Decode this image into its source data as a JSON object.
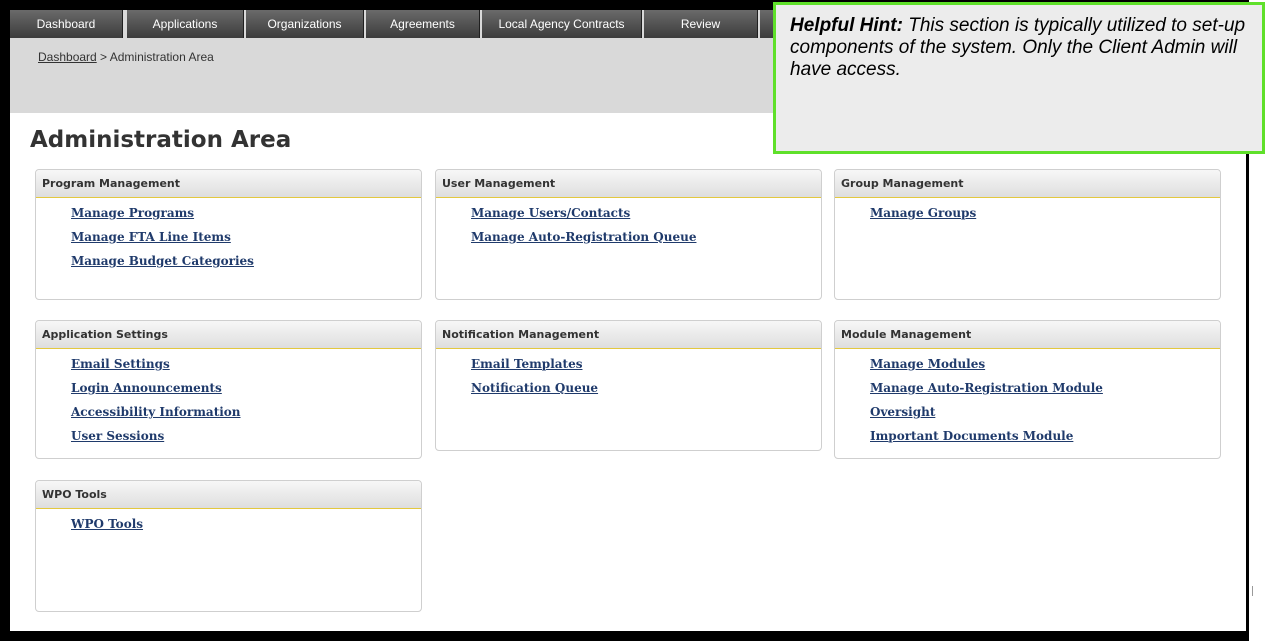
{
  "nav": {
    "tabs": [
      {
        "label": "Dashboard"
      },
      {
        "label": "Applications"
      },
      {
        "label": "Organizations"
      },
      {
        "label": "Agreements"
      },
      {
        "label": "Local Agency Contracts"
      },
      {
        "label": "Review"
      },
      {
        "label": ""
      }
    ]
  },
  "breadcrumb": {
    "home": "Dashboard",
    "separator": " > ",
    "current": "Administration Area"
  },
  "page": {
    "title": "Administration Area"
  },
  "panels": [
    {
      "title": "Program Management",
      "links": [
        "Manage Programs",
        "Manage FTA Line Items",
        "Manage Budget Categories"
      ]
    },
    {
      "title": "User Management",
      "links": [
        "Manage Users/Contacts",
        "Manage Auto-Registration Queue"
      ]
    },
    {
      "title": "Group Management",
      "links": [
        "Manage Groups"
      ]
    },
    {
      "title": "Application Settings",
      "links": [
        "Email Settings",
        "Login Announcements",
        "Accessibility Information",
        "User Sessions"
      ]
    },
    {
      "title": "Notification Management",
      "links": [
        "Email Templates",
        "Notification Queue"
      ]
    },
    {
      "title": "Module Management",
      "links": [
        "Manage Modules",
        "Manage Auto-Registration Module",
        "Oversight",
        "Important Documents Module"
      ]
    },
    {
      "title": "WPO Tools",
      "links": [
        "WPO Tools"
      ]
    }
  ],
  "hint": {
    "label": "Helpful Hint:",
    "text": " This section is typically utilized to set-up components of the system. Only the Client Admin will have access."
  },
  "colors": {
    "hint_border": "#5fe02a",
    "panel_rule": "#e3c83f",
    "link": "#1f3a6b"
  }
}
